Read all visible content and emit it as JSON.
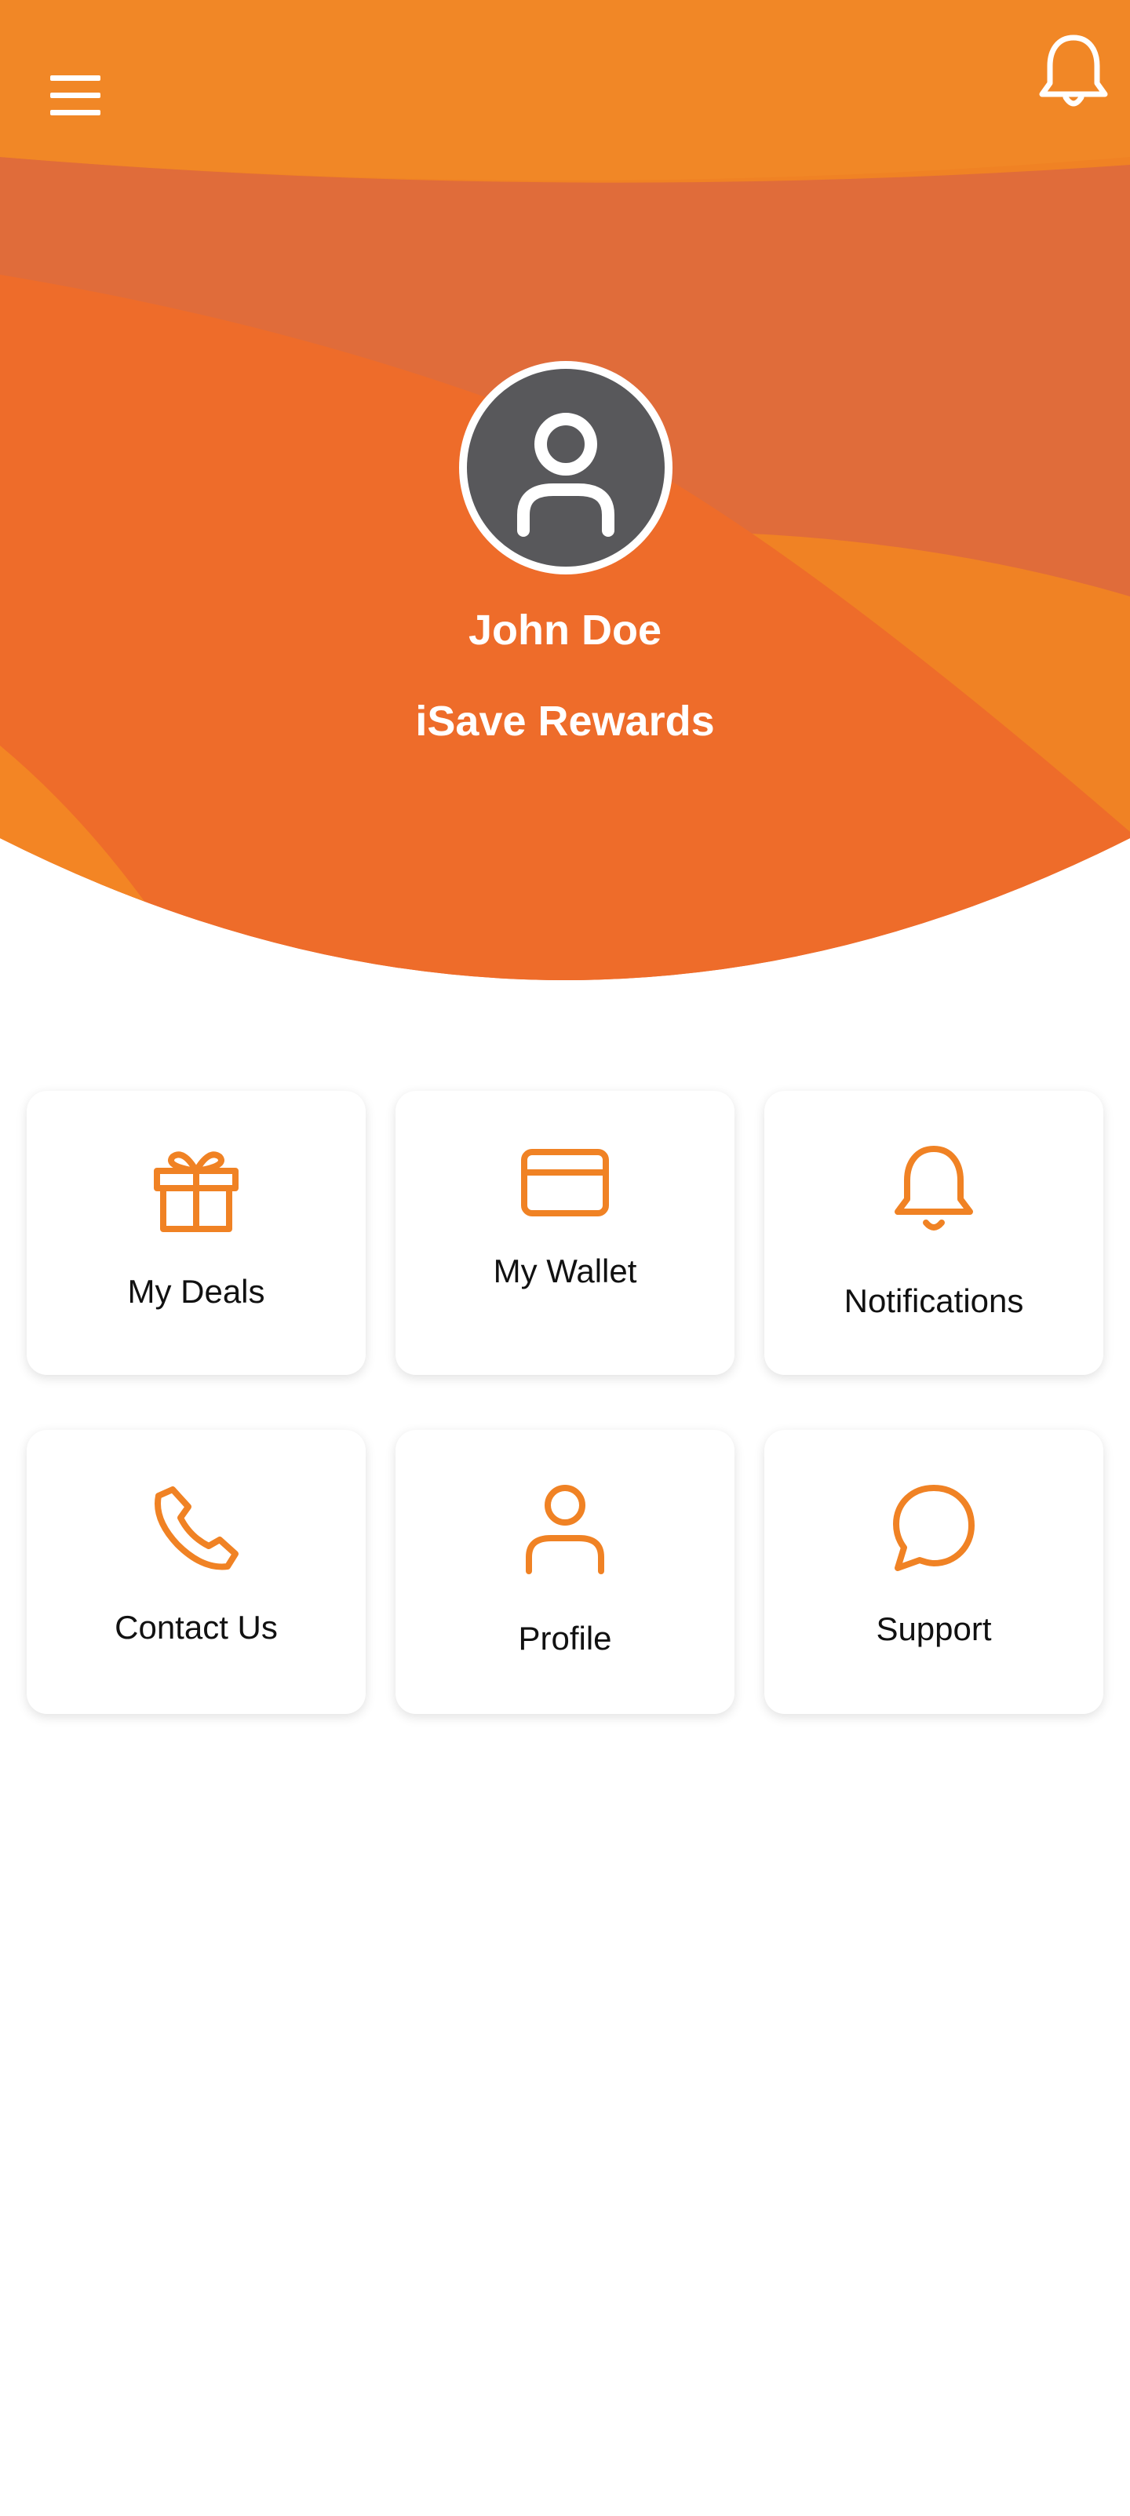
{
  "header": {
    "menu_icon": "hamburger-menu-icon",
    "notification_icon": "bell-icon"
  },
  "profile": {
    "avatar_icon": "user-icon",
    "name": "John Doe",
    "program": "iSave Rewards"
  },
  "colors": {
    "accent": "#F08224",
    "header_light": "#F18726",
    "header_mid": "#E06C3A",
    "header_dark": "#EE6C2A",
    "avatar_bg": "#58585B"
  },
  "tiles": [
    {
      "label": "My Deals",
      "icon": "gift-icon"
    },
    {
      "label": "My Wallet",
      "icon": "credit-card-icon"
    },
    {
      "label": "Notifications",
      "icon": "bell-icon"
    },
    {
      "label": "Contact Us",
      "icon": "phone-icon"
    },
    {
      "label": "Profile",
      "icon": "user-icon"
    },
    {
      "label": "Support",
      "icon": "chat-bubble-icon"
    }
  ]
}
